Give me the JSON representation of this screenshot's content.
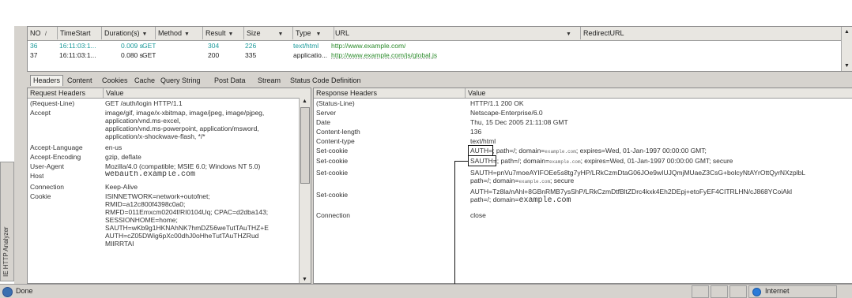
{
  "side_tab": "IE HTTP Analyzer",
  "sessions": {
    "columns": [
      {
        "label": "NO",
        "sort": "/"
      },
      {
        "label": "TimeStart",
        "sort": ""
      },
      {
        "label": "Duration(s)",
        "sort": "▼"
      },
      {
        "label": "Method",
        "sort": "▼"
      },
      {
        "label": "Result",
        "sort": "▼"
      },
      {
        "label": "Size",
        "sort": "▼"
      },
      {
        "label": "Type",
        "sort": "▼"
      },
      {
        "label": "URL",
        "sort": "▼"
      },
      {
        "label": "RedirectURL",
        "sort": ""
      }
    ],
    "rows": [
      {
        "no": "36",
        "time": "16:11:03:1...",
        "duration": "0.009 s",
        "method": "GET",
        "result": "304",
        "size": "226",
        "type": "text/html",
        "url": "http://www.example.com/"
      },
      {
        "no": "37",
        "time": "16:11:03:1...",
        "duration": "0.080 s",
        "method": "GET",
        "result": "200",
        "size": "335",
        "type": "applicatio...",
        "url": "http://www.example.com/js/global.js"
      }
    ]
  },
  "tabs": [
    "Headers",
    "Content",
    "Cookies",
    "Cache",
    "Query String",
    "Post Data",
    "Stream",
    "Status Code Definition"
  ],
  "request": {
    "col1": "Request Headers",
    "col2": "Value",
    "rows": [
      {
        "k": "(Request-Line)",
        "v": "GET /auth/login HTTP/1.1"
      },
      {
        "k": "Accept",
        "v": "image/gif, image/x-xbitmap, image/jpeg, image/pjpeg,\napplication/vnd.ms-excel,\napplication/vnd.ms-powerpoint, application/msword,\napplication/x-shockwave-flash, */*"
      },
      {
        "k": "Accept-Language",
        "v": "en-us"
      },
      {
        "k": "Accept-Encoding",
        "v": "gzip, deflate"
      },
      {
        "k": "User-Agent",
        "v": "Mozilla/4.0 (compatible; MSIE 6.0; Windows NT 5.0)"
      },
      {
        "k": "Host",
        "v": "webauth.example.com"
      },
      {
        "k": "Connection",
        "v": "Keep-Alive"
      },
      {
        "k": "Cookie",
        "v": "ISINNETWORK=network+outofnet;\nRMID=a12c800f4398c0a0;\nRMFD=011Emxcm0204f/RI0104Uq; CPAC=d2dba143;\nSESSIONHOME=home;\nSAUTH=wKb9g1HKNAhNK7hmDZ56weTutTAuTHZ+E\nAUTH=cZ05DWig6pXc00dhJ0oHheTutTAuTHZRud\nMIIRRTAI"
      }
    ]
  },
  "response": {
    "col1": "Response Headers",
    "col2": "Value",
    "rows": [
      {
        "k": "(Status-Line)",
        "v": "HTTP/1.1 200 OK"
      },
      {
        "k": "Server",
        "v": "Netscape-Enterprise/6.0"
      },
      {
        "k": "Date",
        "v": "Thu, 15 Dec 2005 21:11:08 GMT"
      },
      {
        "k": "Content-length",
        "v": "136"
      },
      {
        "k": "Content-type",
        "v": "text/html"
      },
      {
        "k": "Set-cookie",
        "box": "AUTH=",
        "pre": "; path=/; domain=",
        "dom": "example.com",
        "post": "; expires=Wed, 01-Jan-1997 00:00:00 GMT;"
      },
      {
        "k": "Set-cookie",
        "box": "SAUTH=",
        "pre": "; path=/; domain=",
        "dom": "example.com",
        "post": "; expires=Wed, 01-Jan-1997 00:00:00 GMT; secure"
      },
      {
        "k": "Set-cookie",
        "line1": "SAUTH=pnVu7moeAYIFOEe5s8tg7yHP/LRkCzmDtaG06JOe9wIUJQmjMUaeZ3CsG+bolcyNtAYrOttQyrNXzplbL",
        "pre": "path=/; domain=",
        "dom": "example.com",
        "post": "; secure"
      },
      {
        "k": "Set-cookie",
        "line1": "AUTH=Tz8la/nAhl+8GBnRMB7ysShP/LRkCzmDtfBltZDrc4kxk4Eh2DEpj+etoFyEF4CITRLHN/cJ868YCoiAkl",
        "pre": "path=/; domain=",
        "dom": "example.com",
        "post": ""
      },
      {
        "k": "Connection",
        "v": "close"
      }
    ]
  },
  "status": {
    "left": "Done",
    "right": "Internet"
  },
  "colors": {
    "chrome": "#d6d3ce",
    "accent_teal": "#1a9a9a",
    "url_green": "#2a8a2a"
  }
}
